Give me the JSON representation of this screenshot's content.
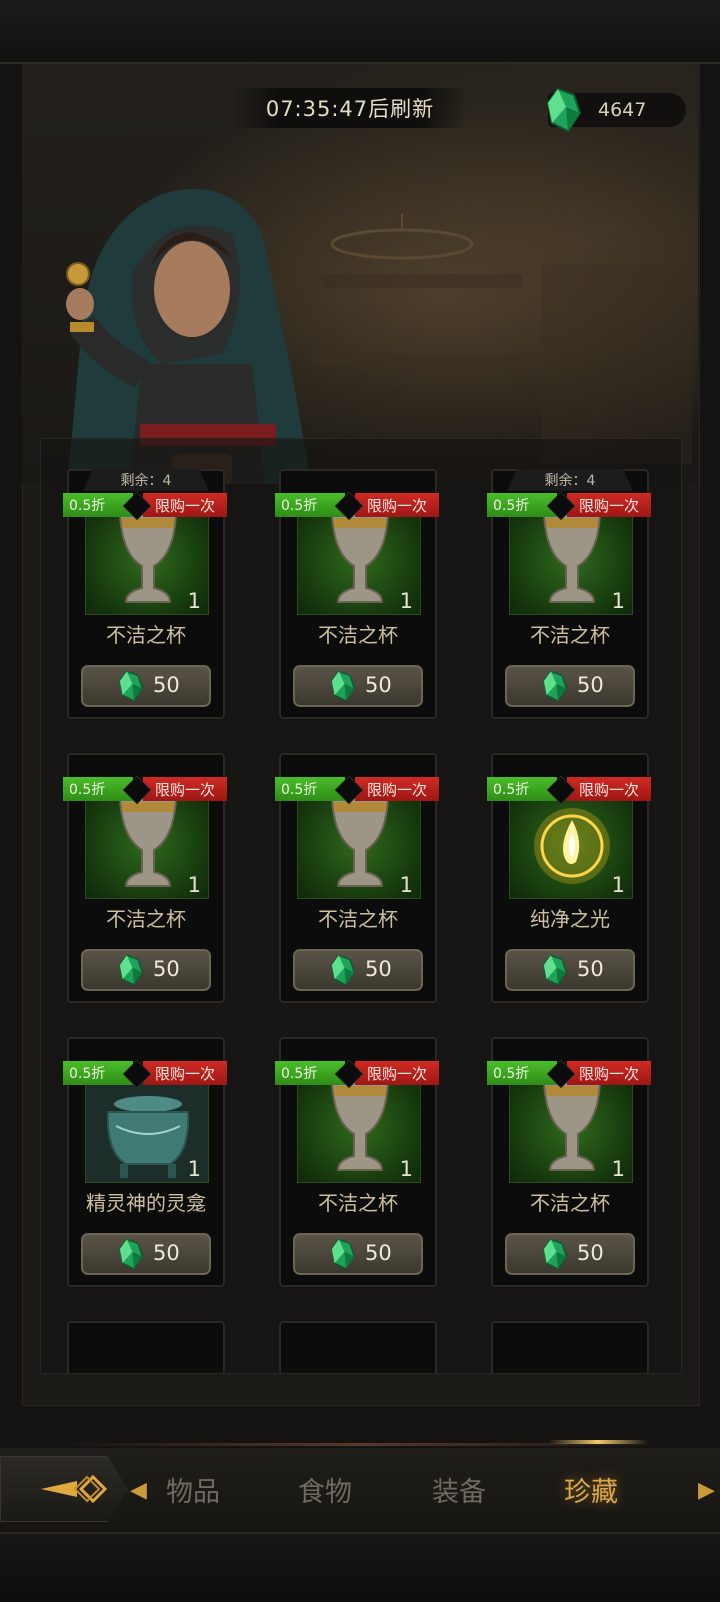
{
  "header": {
    "refresh_timer": "07:35:47后刷新",
    "currency_amount": "4647",
    "currency_icon": "green-gem-icon"
  },
  "colors": {
    "discount_tag": "#3aa51f",
    "limit_tag": "#c0201b",
    "active_tab": "#d9a64a",
    "inactive_tab": "#6f6a5f"
  },
  "shop": {
    "items": [
      {
        "remaining": "剩余：4",
        "discount": "0.5折",
        "limit": "限购一次",
        "quantity": "1",
        "name": "不洁之杯",
        "price": "50",
        "icon": "chalice-icon"
      },
      {
        "remaining": "",
        "discount": "0.5折",
        "limit": "限购一次",
        "quantity": "1",
        "name": "不洁之杯",
        "price": "50",
        "icon": "chalice-icon"
      },
      {
        "remaining": "剩余：4",
        "discount": "0.5折",
        "limit": "限购一次",
        "quantity": "1",
        "name": "不洁之杯",
        "price": "50",
        "icon": "chalice-icon"
      },
      {
        "remaining": "",
        "discount": "0.5折",
        "limit": "限购一次",
        "quantity": "1",
        "name": "不洁之杯",
        "price": "50",
        "icon": "chalice-icon"
      },
      {
        "remaining": "",
        "discount": "0.5折",
        "limit": "限购一次",
        "quantity": "1",
        "name": "不洁之杯",
        "price": "50",
        "icon": "chalice-icon"
      },
      {
        "remaining": "",
        "discount": "0.5折",
        "limit": "限购一次",
        "quantity": "1",
        "name": "纯净之光",
        "price": "50",
        "icon": "light-orb-icon"
      },
      {
        "remaining": "",
        "discount": "0.5折",
        "limit": "限购一次",
        "quantity": "1",
        "name": "精灵神的灵龛",
        "price": "50",
        "icon": "shrine-urn-icon"
      },
      {
        "remaining": "",
        "discount": "0.5折",
        "limit": "限购一次",
        "quantity": "1",
        "name": "不洁之杯",
        "price": "50",
        "icon": "chalice-icon"
      },
      {
        "remaining": "",
        "discount": "0.5折",
        "limit": "限购一次",
        "quantity": "1",
        "name": "不洁之杯",
        "price": "50",
        "icon": "chalice-icon"
      }
    ]
  },
  "nav": {
    "tabs": [
      {
        "label": "物品",
        "active": false
      },
      {
        "label": "食物",
        "active": false
      },
      {
        "label": "装备",
        "active": false
      },
      {
        "label": "珍藏",
        "active": true
      }
    ]
  }
}
